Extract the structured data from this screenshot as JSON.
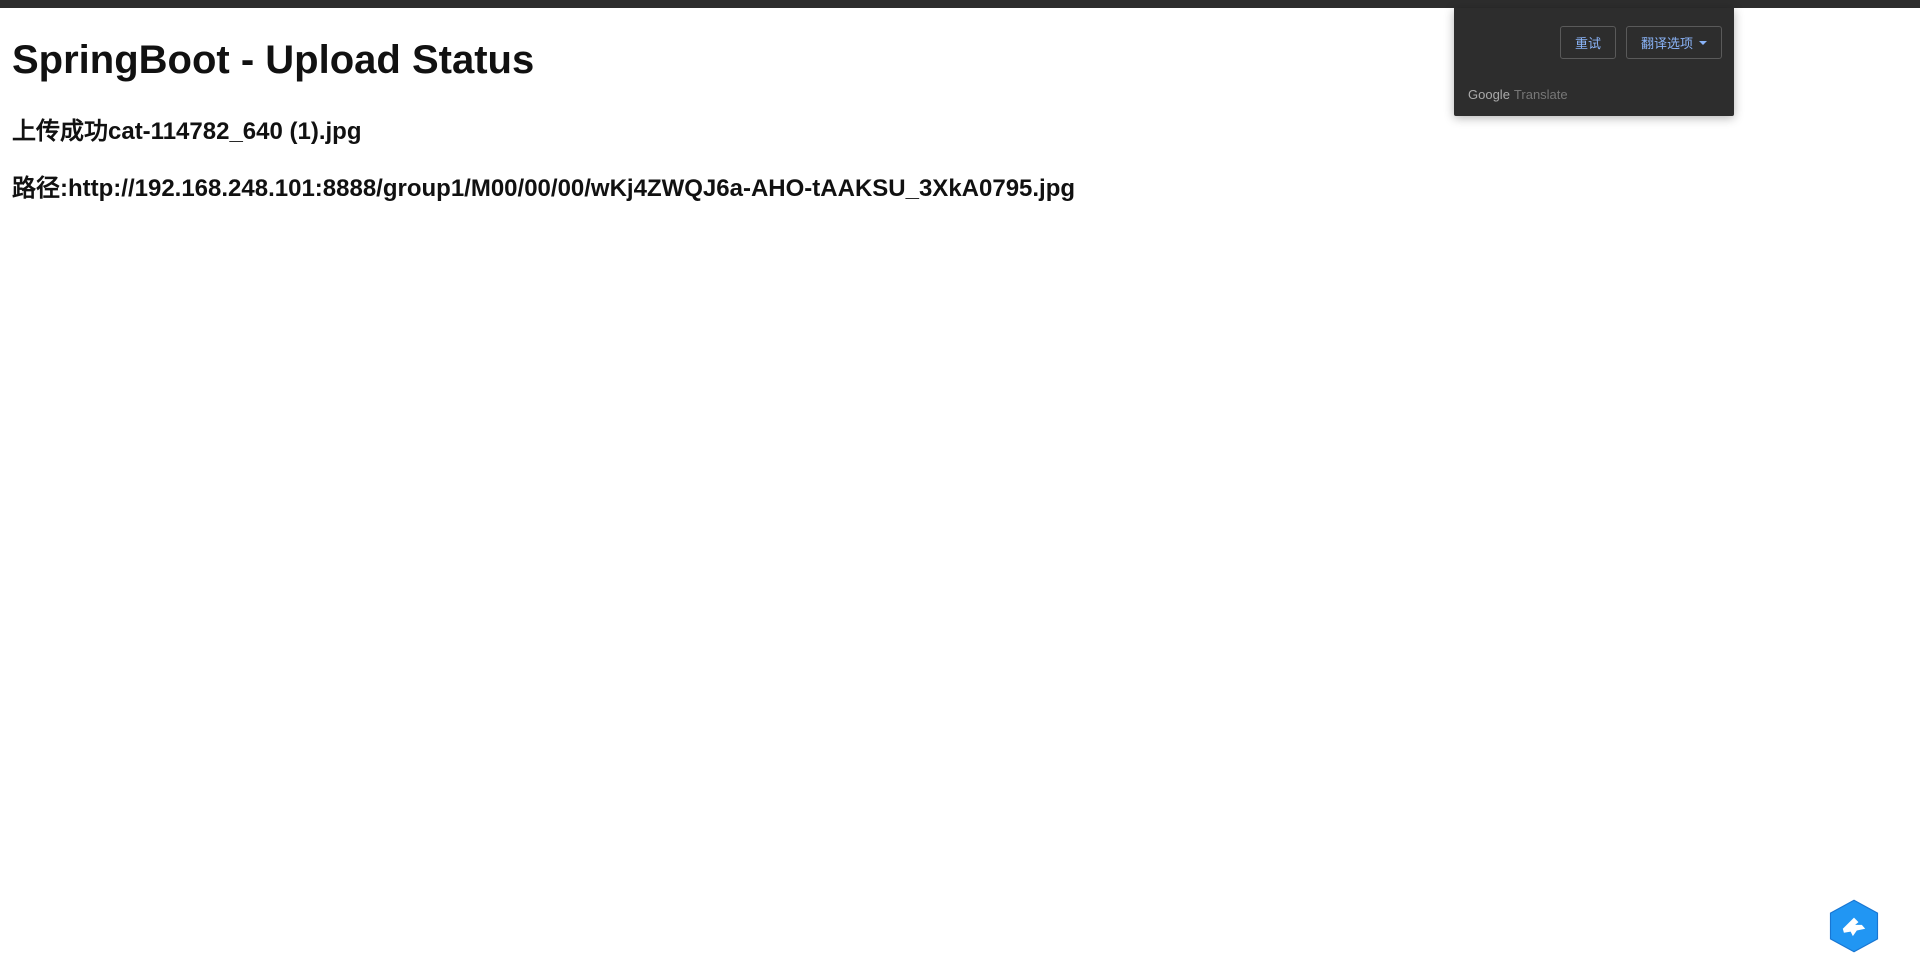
{
  "page": {
    "title": "SpringBoot - Upload Status",
    "upload_status": "上传成功cat-114782_640 (1).jpg",
    "path_line": "路径:http://192.168.248.101:8888/group1/M00/00/00/wKj4ZWQJ6a-AHO-tAAKSU_3XkA0795.jpg"
  },
  "translate": {
    "retry_label": "重试",
    "options_label": "翻译选项",
    "brand_logo": "Google",
    "brand_label": "Translate"
  },
  "colors": {
    "popup_bg": "#2d2d2d",
    "link_blue": "#8ab4f8",
    "badge_blue": "#2196f3"
  }
}
